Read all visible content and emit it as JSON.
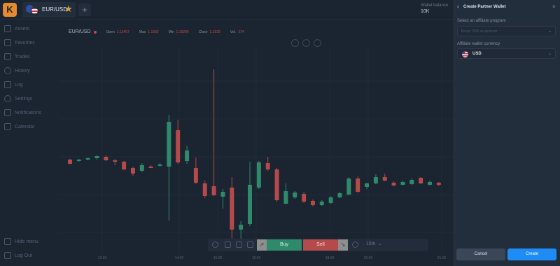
{
  "topbar": {
    "logo_letter": "K",
    "pair_tab_label": "EUR/USD",
    "star_icon": "star-icon",
    "add_tab_label": "+",
    "balance_label": "Wallet balance",
    "balance_value": "10K"
  },
  "sidebar": {
    "items": [
      {
        "label": "Assets",
        "icon": "assets-icon"
      },
      {
        "label": "Favorites",
        "icon": "favorites-icon"
      },
      {
        "label": "Trades",
        "icon": "trades-icon"
      },
      {
        "label": "History",
        "icon": "history-icon"
      },
      {
        "label": "Log",
        "icon": "log-icon"
      },
      {
        "label": "Settings",
        "icon": "settings-icon"
      },
      {
        "label": "Notifications",
        "icon": "notifications-icon"
      },
      {
        "label": "Calendar",
        "icon": "calendar-icon"
      }
    ],
    "hide_menu_label": "Hide menu",
    "logout_label": "Log Out"
  },
  "chart_header": {
    "pair": "EUR/USD",
    "open_key": "Open",
    "open_val": "1.15457",
    "max_key": "Max",
    "max_val": "1.1583",
    "min_key": "Min",
    "min_val": "1.15290",
    "close_key": "Close",
    "close_val": "1.1530",
    "vol_key": "Vol.",
    "vol_val": "374"
  },
  "chart_data": {
    "type": "candlestick",
    "x_ticks": [
      "12:00",
      "14:00",
      "15:00",
      "16:00",
      "18:00",
      "20:00",
      "21:00"
    ],
    "up_color": "#2e8a6a",
    "down_color": "#b44a4a",
    "candles": [
      {
        "dir": "down",
        "o": 10,
        "c": 16,
        "h": 9,
        "l": 17
      },
      {
        "dir": "up",
        "o": 12,
        "c": 10,
        "h": 9,
        "l": 13
      },
      {
        "dir": "up",
        "o": 9,
        "c": 8,
        "h": 7,
        "l": 11
      },
      {
        "dir": "up",
        "o": 8,
        "c": 5,
        "h": 4,
        "l": 10
      },
      {
        "dir": "down",
        "o": 6,
        "c": 11,
        "h": 4,
        "l": 12
      },
      {
        "dir": "down",
        "o": 11,
        "c": 12,
        "h": 9,
        "l": 18
      },
      {
        "dir": "down",
        "o": 13,
        "c": 24,
        "h": 12,
        "l": 25
      },
      {
        "dir": "down",
        "o": 22,
        "c": 30,
        "h": 20,
        "l": 33
      },
      {
        "dir": "up",
        "o": 26,
        "c": 18,
        "h": 15,
        "l": 28
      },
      {
        "dir": "down",
        "o": 20,
        "c": 20,
        "h": 18,
        "l": 22
      },
      {
        "dir": "up",
        "o": 19,
        "c": 17,
        "h": 15,
        "l": 20
      },
      {
        "dir": "up",
        "o": 20,
        "c": -44,
        "h": -54,
        "l": 97
      },
      {
        "dir": "down",
        "o": -32,
        "c": 14,
        "h": -47,
        "l": 16
      },
      {
        "dir": "up",
        "o": 12,
        "c": -3,
        "h": -10,
        "l": 16
      },
      {
        "dir": "down",
        "o": 22,
        "c": 43,
        "h": 7,
        "l": 45
      },
      {
        "dir": "down",
        "o": 44,
        "c": 62,
        "h": 40,
        "l": 65
      },
      {
        "dir": "down",
        "o": 48,
        "c": 61,
        "h": -119,
        "l": 62
      },
      {
        "dir": "up",
        "o": 63,
        "c": 56,
        "h": 52,
        "l": 80
      },
      {
        "dir": "down",
        "o": 50,
        "c": 110,
        "h": 35,
        "l": 124
      },
      {
        "dir": "up",
        "o": 110,
        "c": 103,
        "h": 98,
        "l": 125
      },
      {
        "dir": "up",
        "o": 102,
        "c": 46,
        "h": 13,
        "l": 105
      },
      {
        "dir": "up",
        "o": 50,
        "c": 14,
        "h": 12,
        "l": 52
      },
      {
        "dir": "down",
        "o": 15,
        "c": 24,
        "h": 6,
        "l": 26
      },
      {
        "dir": "down",
        "o": 24,
        "c": 68,
        "h": 22,
        "l": 70
      },
      {
        "dir": "up",
        "o": 73,
        "c": 55,
        "h": 44,
        "l": 74
      },
      {
        "dir": "up",
        "o": 64,
        "c": 57,
        "h": 55,
        "l": 66
      },
      {
        "dir": "down",
        "o": 59,
        "c": 70,
        "h": 56,
        "l": 72
      },
      {
        "dir": "down",
        "o": 69,
        "c": 75,
        "h": 67,
        "l": 77
      },
      {
        "dir": "up",
        "o": 75,
        "c": 70,
        "h": 68,
        "l": 76
      },
      {
        "dir": "up",
        "o": 72,
        "c": 64,
        "h": 62,
        "l": 73
      },
      {
        "dir": "up",
        "o": 64,
        "c": 58,
        "h": 56,
        "l": 65
      },
      {
        "dir": "up",
        "o": 60,
        "c": 37,
        "h": 35,
        "l": 61
      },
      {
        "dir": "down",
        "o": 37,
        "c": 56,
        "h": 34,
        "l": 57
      },
      {
        "dir": "up",
        "o": 49,
        "c": 44,
        "h": 43,
        "l": 52
      },
      {
        "dir": "up",
        "o": 44,
        "c": 35,
        "h": 31,
        "l": 45
      },
      {
        "dir": "down",
        "o": 35,
        "c": 40,
        "h": 30,
        "l": 41
      },
      {
        "dir": "down",
        "o": 43,
        "c": 47,
        "h": 41,
        "l": 48
      },
      {
        "dir": "up",
        "o": 46,
        "c": 42,
        "h": 40,
        "l": 47
      },
      {
        "dir": "up",
        "o": 45,
        "c": 39,
        "h": 37,
        "l": 46
      },
      {
        "dir": "down",
        "o": 36,
        "c": 44,
        "h": 35,
        "l": 45
      },
      {
        "dir": "up",
        "o": 46,
        "c": 42,
        "h": 40,
        "l": 47
      },
      {
        "dir": "down",
        "o": 43,
        "c": 46,
        "h": 42,
        "l": 48
      }
    ]
  },
  "toolbar": {
    "buy_label": "Buy",
    "sell_label": "Sell",
    "buy_arrow": "↗",
    "sell_arrow": "↘",
    "timeframe": "15m",
    "timeframe_chev": "⌄"
  },
  "panel": {
    "back_icon": "‹",
    "title": "Create Partner Wallet",
    "close_icon": "×",
    "program_label": "Select an affiliate program",
    "program_placeholder": "Бонус 20% за депозит",
    "program_chev": "⌄",
    "currency_label": "Affiliate wallet currency",
    "currency_value": "USD",
    "currency_chev": "⌄",
    "cancel_label": "Cancel",
    "create_label": "Create"
  }
}
